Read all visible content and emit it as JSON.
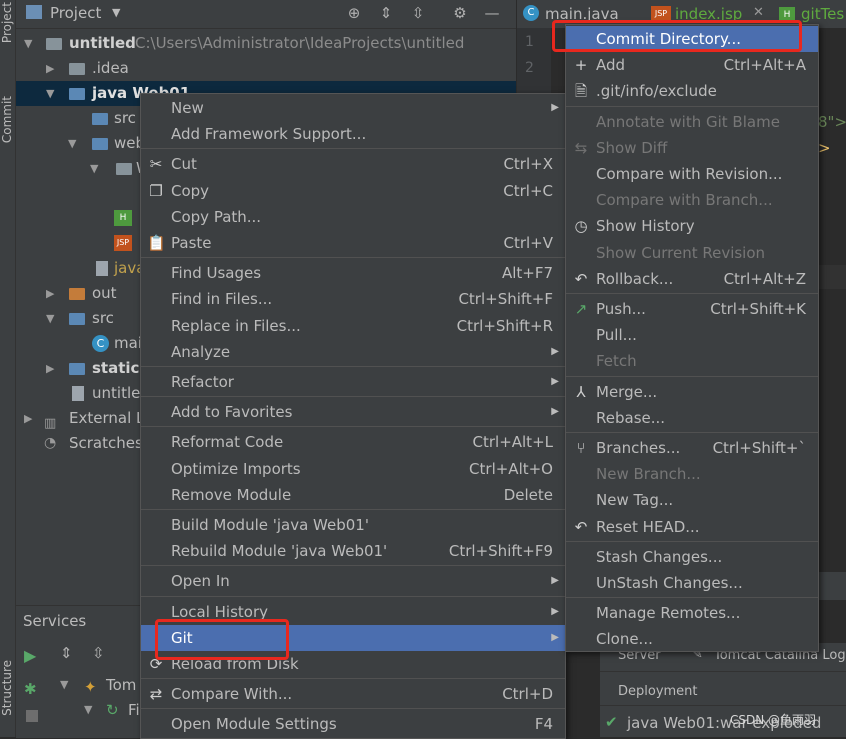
{
  "left_strip": {
    "project_label": "Project",
    "commit_label": "Commit",
    "structure_label": "Structure"
  },
  "project_panel": {
    "title": "Project",
    "tree": [
      {
        "label": "untitled",
        "path": "C:\\Users\\Administrator\\IdeaProjects\\untitled"
      },
      {
        "label": ".idea"
      },
      {
        "label": "java Web01"
      },
      {
        "label": "src"
      },
      {
        "label": "web"
      },
      {
        "label": "W"
      },
      {
        "label": "java"
      },
      {
        "label": "out"
      },
      {
        "label": "src"
      },
      {
        "label": "mai"
      },
      {
        "label": "staticw"
      },
      {
        "label": "untitle"
      },
      {
        "label": "External L"
      },
      {
        "label": "Scratches"
      }
    ]
  },
  "editor": {
    "tabs": [
      {
        "label": "main.java",
        "icon": "class-icon"
      },
      {
        "label": "index.jsp",
        "icon": "jsp-icon"
      },
      {
        "label": "gitTes",
        "icon": "html-icon"
      }
    ],
    "line_numbers": [
      "1",
      "2"
    ],
    "code_fragments": [
      "8\">",
      ">"
    ]
  },
  "services": {
    "title": "Services",
    "items": [
      "Tom",
      "Fi"
    ],
    "tabs": [
      "Server",
      "Tomcat Catalina Log"
    ],
    "deployment_label": "Deployment",
    "deployment_item": "java Web01:war exploded"
  },
  "watermark": "CSDN @鱼雨羽",
  "context_menu": [
    {
      "label": "New",
      "submenu": true
    },
    {
      "label": "Add Framework Support..."
    },
    {
      "sep": true
    },
    {
      "label": "Cut",
      "shortcut": "Ctrl+X",
      "icon": "scissors-icon"
    },
    {
      "label": "Copy",
      "shortcut": "Ctrl+C",
      "icon": "copy-icon"
    },
    {
      "label": "Copy Path..."
    },
    {
      "label": "Paste",
      "shortcut": "Ctrl+V",
      "icon": "paste-icon"
    },
    {
      "sep": true
    },
    {
      "label": "Find Usages",
      "shortcut": "Alt+F7"
    },
    {
      "label": "Find in Files...",
      "shortcut": "Ctrl+Shift+F"
    },
    {
      "label": "Replace in Files...",
      "shortcut": "Ctrl+Shift+R"
    },
    {
      "label": "Analyze",
      "submenu": true
    },
    {
      "sep": true
    },
    {
      "label": "Refactor",
      "submenu": true
    },
    {
      "sep": true
    },
    {
      "label": "Add to Favorites",
      "submenu": true
    },
    {
      "sep": true
    },
    {
      "label": "Reformat Code",
      "shortcut": "Ctrl+Alt+L"
    },
    {
      "label": "Optimize Imports",
      "shortcut": "Ctrl+Alt+O"
    },
    {
      "label": "Remove Module",
      "shortcut": "Delete"
    },
    {
      "sep": true
    },
    {
      "label": "Build Module 'java Web01'"
    },
    {
      "label": "Rebuild Module 'java Web01'",
      "shortcut": "Ctrl+Shift+F9"
    },
    {
      "sep": true
    },
    {
      "label": "Open In",
      "submenu": true
    },
    {
      "sep": true
    },
    {
      "label": "Local History",
      "submenu": true
    },
    {
      "label": "Git",
      "submenu": true,
      "highlighted": true
    },
    {
      "label": "Reload from Disk",
      "icon": "reload-icon"
    },
    {
      "sep": true
    },
    {
      "label": "Compare With...",
      "shortcut": "Ctrl+D",
      "icon": "compare-icon"
    },
    {
      "sep": true
    },
    {
      "label": "Open Module Settings",
      "shortcut": "F4"
    }
  ],
  "git_menu": [
    {
      "label": "Commit Directory...",
      "highlighted": true
    },
    {
      "label": "Add",
      "shortcut": "Ctrl+Alt+A",
      "icon": "plus-icon"
    },
    {
      "label": ".git/info/exclude",
      "icon": "git-file-icon"
    },
    {
      "sep": true
    },
    {
      "label": "Annotate with Git Blame",
      "disabled": true
    },
    {
      "label": "Show Diff",
      "disabled": true,
      "icon": "diff-icon"
    },
    {
      "label": "Compare with Revision..."
    },
    {
      "label": "Compare with Branch...",
      "disabled": true
    },
    {
      "label": "Show History",
      "icon": "clock-icon"
    },
    {
      "label": "Show Current Revision",
      "disabled": true
    },
    {
      "label": "Rollback...",
      "shortcut": "Ctrl+Alt+Z",
      "icon": "rollback-icon"
    },
    {
      "sep": true
    },
    {
      "label": "Push...",
      "shortcut": "Ctrl+Shift+K",
      "icon": "push-icon"
    },
    {
      "label": "Pull..."
    },
    {
      "label": "Fetch",
      "disabled": true
    },
    {
      "sep": true
    },
    {
      "label": "Merge...",
      "icon": "merge-icon"
    },
    {
      "label": "Rebase..."
    },
    {
      "sep": true
    },
    {
      "label": "Branches...",
      "shortcut": "Ctrl+Shift+`",
      "icon": "branch-icon"
    },
    {
      "label": "New Branch...",
      "disabled": true
    },
    {
      "label": "New Tag..."
    },
    {
      "label": "Reset HEAD...",
      "icon": "reset-icon"
    },
    {
      "sep": true
    },
    {
      "label": "Stash Changes..."
    },
    {
      "label": "UnStash Changes..."
    },
    {
      "sep": true
    },
    {
      "label": "Manage Remotes..."
    },
    {
      "label": "Clone..."
    }
  ]
}
